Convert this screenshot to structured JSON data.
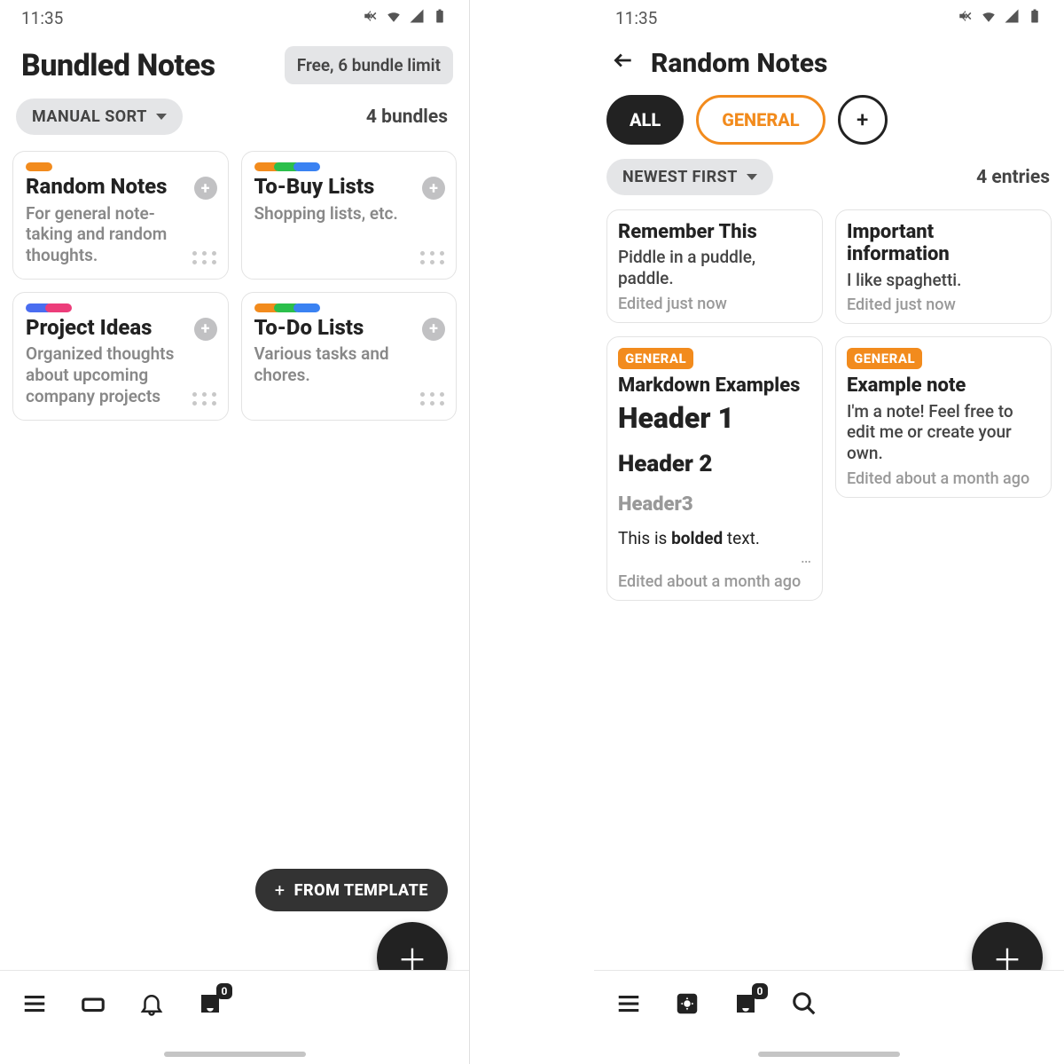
{
  "status_bar": {
    "time": "11:35"
  },
  "screen1": {
    "title": "Bundled Notes",
    "free_chip": "Free, 6 bundle limit",
    "sort_label": "MANUAL SORT",
    "bundles_count": "4 bundles",
    "bundles": [
      {
        "title": "Random Notes",
        "desc": "For general note-taking and random thoughts.",
        "colors": [
          "#f28b1d"
        ]
      },
      {
        "title": "To-Buy Lists",
        "desc": "Shopping lists, etc.",
        "colors": [
          "#f28b1d",
          "#2bbf4b",
          "#3a82f2"
        ]
      },
      {
        "title": "Project Ideas",
        "desc": "Organized thoughts about upcoming company projects",
        "colors": [
          "#4a6df0",
          "#ec3d7a"
        ]
      },
      {
        "title": "To-Do Lists",
        "desc": "Various tasks and chores.",
        "colors": [
          "#f28b1d",
          "#2bbf4b",
          "#3a82f2"
        ]
      }
    ],
    "fab_template": "FROM TEMPLATE",
    "nav_badge": "0"
  },
  "screen2": {
    "title": "Random Notes",
    "filters": {
      "all": "ALL",
      "general": "GENERAL",
      "add": "+"
    },
    "sort_label": "NEWEST FIRST",
    "entries_count": "4 entries",
    "entries": [
      {
        "title": "Remember This",
        "body": "Piddle in a puddle, paddle.",
        "time": "Edited just now"
      },
      {
        "title": "Important information",
        "body": "I like spaghetti.",
        "time": "Edited just now"
      },
      {
        "tag": "GENERAL",
        "title": "Markdown Examples",
        "md_h1": "Header 1",
        "md_h2": "Header 2",
        "md_h3": "Header3",
        "md_text_pre": "This is ",
        "md_text_bold": "bolded",
        "md_text_post": " text.",
        "time": "Edited about a month ago"
      },
      {
        "tag": "GENERAL",
        "title": "Example note",
        "body": "I'm a note! Feel free to edit me or create your own.",
        "time": "Edited about a month ago"
      }
    ],
    "nav_badge": "0"
  }
}
